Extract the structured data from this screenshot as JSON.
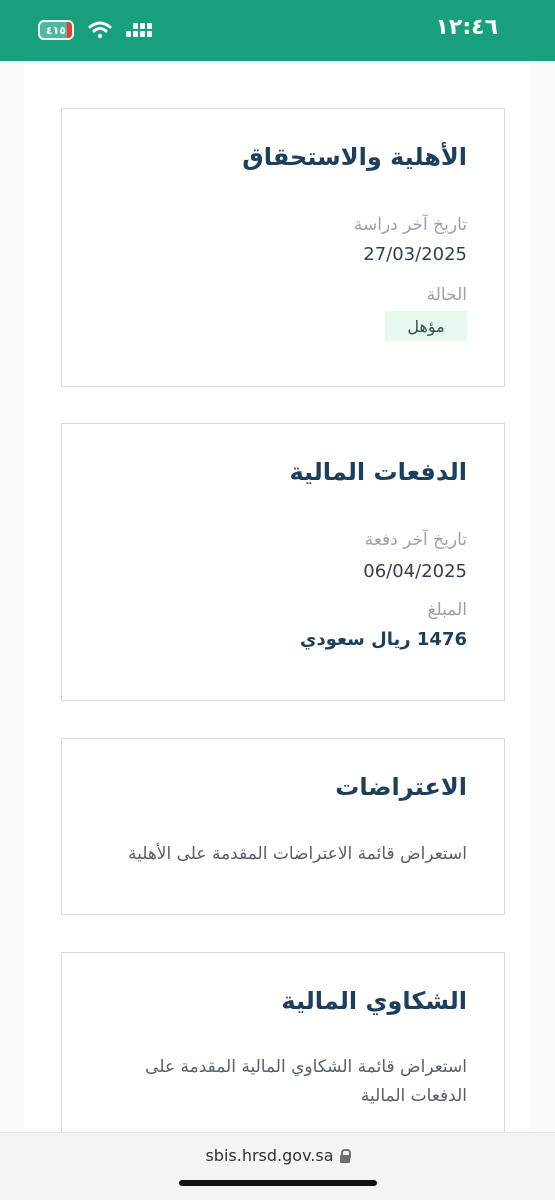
{
  "status_bar": {
    "time": "١٢:٤٦",
    "battery_text": "٤١٥",
    "icons": [
      "signal-icon",
      "wifi-icon",
      "battery-icon"
    ],
    "color": "#18a07c"
  },
  "eligibility": {
    "title": "الأهلية والاستحقاق",
    "last_study_label": "تاريخ آخر دراسة",
    "last_study_date": "27/03/2025",
    "status_label": "الحالة",
    "status_value": "مؤهل"
  },
  "payments": {
    "title": "الدفعات المالية",
    "last_payment_label": "تاريخ آخر دفعة",
    "last_payment_date": "06/04/2025",
    "amount_label": "المبلغ",
    "amount_value": "1476 ريال سعودي"
  },
  "objections": {
    "title": "الاعتراضات",
    "description": "استعراض قائمة الاعتراضات المقدمة على الأهلية"
  },
  "complaints": {
    "title": "الشكاوي المالية",
    "description": "استعراض قائمة الشكاوي المالية المقدمة على الدفعات المالية"
  },
  "browser": {
    "url": "sbis.hrsd.gov.sa"
  }
}
